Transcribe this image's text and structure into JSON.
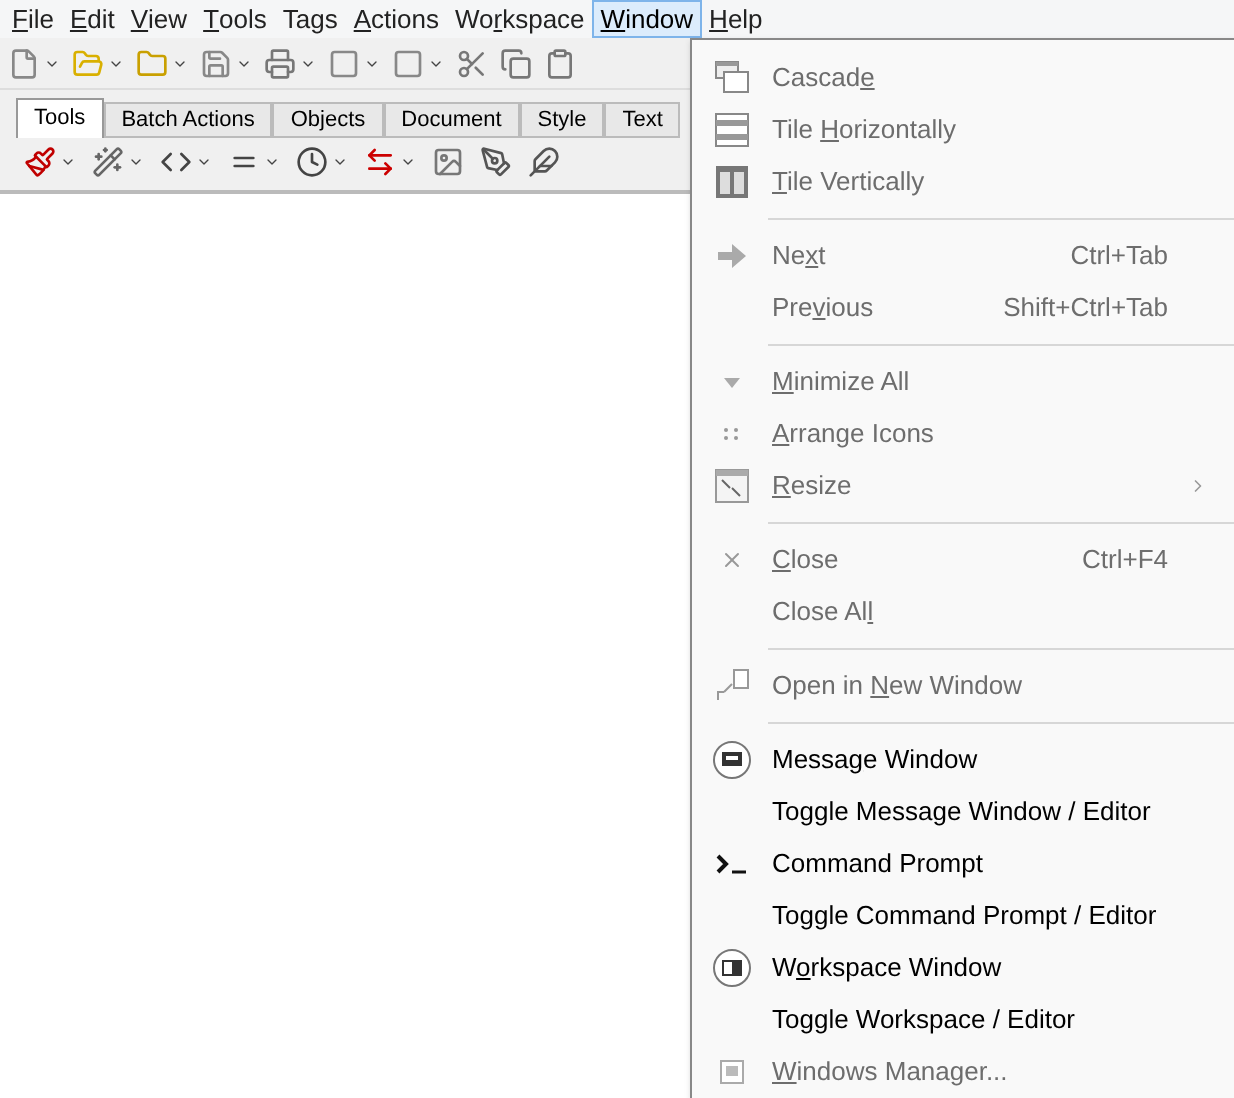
{
  "menu_bar": [
    {
      "key": "F",
      "after": "ile",
      "selected": false
    },
    {
      "key": "E",
      "after": "dit",
      "selected": false
    },
    {
      "key": "V",
      "after": "iew",
      "selected": false
    },
    {
      "key": "T",
      "after": "ools",
      "selected": false
    },
    {
      "before": "Ta",
      "key": "g",
      "after": "s",
      "selected": false
    },
    {
      "key": "A",
      "after": "ctions",
      "selected": false
    },
    {
      "before": "Wo",
      "key": "r",
      "after": "kspace",
      "selected": false
    },
    {
      "key": "W",
      "after": "indow",
      "selected": true
    },
    {
      "key": "H",
      "after": "elp",
      "selected": false
    }
  ],
  "tabs": [
    {
      "label": "Tools",
      "selected": true
    },
    {
      "label": "Batch Actions",
      "selected": false
    },
    {
      "label": "Objects",
      "selected": false
    },
    {
      "label": "Document",
      "selected": false
    },
    {
      "label": "Style",
      "selected": false
    },
    {
      "label": "Text",
      "selected": false
    }
  ],
  "window_menu": [
    {
      "kind": "item",
      "before": "Cascad",
      "key": "e",
      "disabled": true
    },
    {
      "kind": "item",
      "before": "Tile ",
      "key": "H",
      "after": "orizontally",
      "disabled": true
    },
    {
      "kind": "item",
      "key": "T",
      "after": "ile Vertically",
      "disabled": true
    },
    {
      "kind": "separator"
    },
    {
      "kind": "item",
      "before": "Ne",
      "key": "x",
      "after": "t",
      "shortcut": "Ctrl+Tab",
      "disabled": true
    },
    {
      "kind": "item",
      "before": "Pre",
      "key": "v",
      "after": "ious",
      "shortcut": "Shift+Ctrl+Tab",
      "disabled": true
    },
    {
      "kind": "separator"
    },
    {
      "kind": "item",
      "key": "M",
      "after": "inimize All",
      "disabled": true
    },
    {
      "kind": "item",
      "key": "A",
      "after": "rrange Icons",
      "disabled": true
    },
    {
      "kind": "item",
      "key": "R",
      "after": "esize",
      "submenu": true,
      "disabled": true
    },
    {
      "kind": "separator"
    },
    {
      "kind": "item",
      "key": "C",
      "after": "lose",
      "shortcut": "Ctrl+F4",
      "disabled": true
    },
    {
      "kind": "item",
      "before": "Close Al",
      "key": "l",
      "disabled": true
    },
    {
      "kind": "separator"
    },
    {
      "kind": "item",
      "before": "Open in ",
      "key": "N",
      "after": "ew Window",
      "disabled": true
    },
    {
      "kind": "separator"
    },
    {
      "kind": "item",
      "before": "Messa",
      "key": "g",
      "after": "e Window",
      "disabled": false
    },
    {
      "kind": "item",
      "before": "Toggle Message Window / Editor",
      "disabled": false
    },
    {
      "kind": "item",
      "before": "Command Prompt",
      "disabled": false
    },
    {
      "kind": "item",
      "before": "Toggle Command Prompt / Editor",
      "disabled": false
    },
    {
      "kind": "item",
      "before": "W",
      "key": "o",
      "after": "rkspace Window",
      "disabled": false
    },
    {
      "kind": "item",
      "before": "Toggle Workspace / Editor",
      "disabled": false
    },
    {
      "kind": "item",
      "key": "W",
      "after": "indows Manager...",
      "disabled": true
    }
  ]
}
